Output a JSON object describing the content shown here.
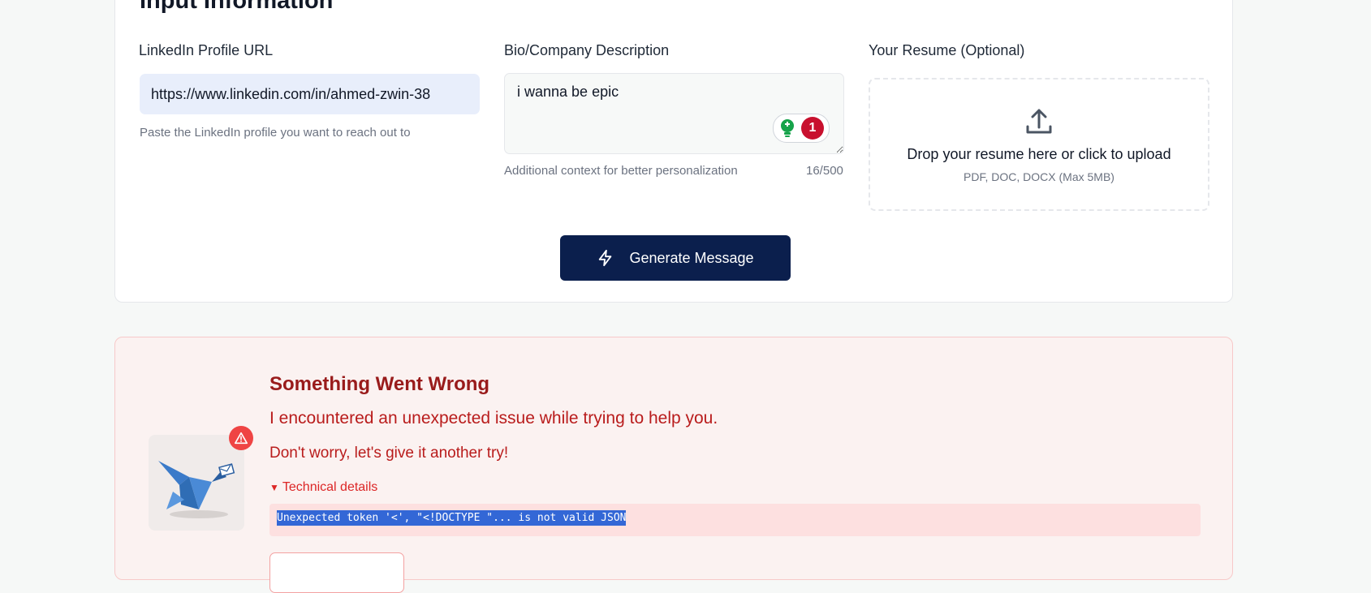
{
  "form": {
    "title": "Input Information",
    "linkedin": {
      "label": "LinkedIn Profile URL",
      "value": "https://www.linkedin.com/in/ahmed-zwin-38",
      "helper": "Paste the LinkedIn profile you want to reach out to"
    },
    "bio": {
      "label": "Bio/Company Description",
      "value": "i wanna be epic",
      "helper": "Additional context for better personalization",
      "counter": "16/500",
      "grammar_issue_count": "1"
    },
    "resume": {
      "label": "Your Resume (Optional)",
      "drop_text": "Drop your resume here or click to upload",
      "formats": "PDF, DOC, DOCX (Max 5MB)"
    },
    "generate_label": "Generate Message"
  },
  "error": {
    "title": "Something Went Wrong",
    "message": "I encountered an unexpected issue while trying to help you.",
    "retry_text": "Don't worry, let's give it another try!",
    "details_toggle": "Technical details",
    "details_code": "Unexpected token '<', \"<!DOCTYPE \"... is not valid JSON"
  },
  "colors": {
    "primary_button": "#0b1f4d",
    "error_text": "#b91c1c",
    "error_bg": "#fbf2f1",
    "input_bg": "#e8eefb"
  },
  "icons": [
    "upload-icon",
    "lightning-icon",
    "lightbulb-icon",
    "warning-icon",
    "origami-bird-icon"
  ]
}
